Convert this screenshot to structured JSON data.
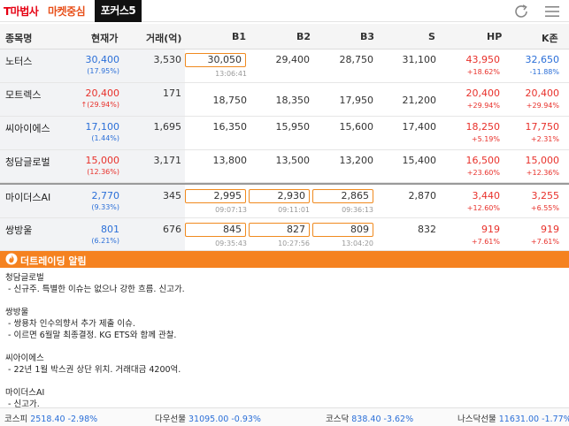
{
  "topbar": {
    "brand": "T마법사",
    "tab_market": "마켓중심",
    "tab_focus": "포커스5"
  },
  "icons": {
    "refresh": "refresh-icon",
    "menu": "menu-icon",
    "alert": "fire-icon"
  },
  "colors": {
    "up": "#e8312b",
    "down": "#2b6fd8",
    "accent": "#f58220",
    "highlight_border": "#f08a1f"
  },
  "table": {
    "headers": {
      "name": "종목명",
      "price": "현재가",
      "volume": "거래(억)",
      "b1": "B1",
      "b2": "B2",
      "b3": "B3",
      "s": "S",
      "hp": "HP",
      "kstop": "K존"
    },
    "rows": [
      {
        "name": "노터스",
        "price": "30,400",
        "pct": "(17.95%)",
        "volume": "3,530",
        "b1": "30,050",
        "b1_time": "13:06:41",
        "b2": "29,400",
        "b3": "28,750",
        "s": "31,100",
        "hp": "43,950",
        "hp_pct": "+18.62%",
        "k": "32,650",
        "k_pct": "-11.88%"
      },
      {
        "name": "모트렉스",
        "price": "20,400",
        "pct": "↑(29.94%)",
        "volume": "171",
        "b1": "18,750",
        "b2": "18,350",
        "b3": "17,950",
        "s": "21,200",
        "hp": "20,400",
        "hp_pct": "+29.94%",
        "k": "20,400",
        "k_pct": "+29.94%"
      },
      {
        "name": "씨아이에스",
        "price": "17,100",
        "pct": "(1.44%)",
        "volume": "1,695",
        "b1": "16,350",
        "b2": "15,950",
        "b3": "15,600",
        "s": "17,400",
        "hp": "18,250",
        "hp_pct": "+5.19%",
        "k": "17,750",
        "k_pct": "+2.31%"
      },
      {
        "name": "청담글로벌",
        "price": "15,000",
        "pct": "(12.36%)",
        "volume": "3,171",
        "b1": "13,800",
        "b2": "13,500",
        "b3": "13,200",
        "s": "15,400",
        "hp": "16,500",
        "hp_pct": "+23.60%",
        "k": "15,000",
        "k_pct": "+12.36%"
      },
      {
        "name": "마이더스AI",
        "price": "2,770",
        "pct": "(9.33%)",
        "volume": "345",
        "b1": "2,995",
        "b1_time": "09:07:13",
        "b2": "2,930",
        "b2_time": "09:11:01",
        "b3": "2,865",
        "b3_time": "09:36:13",
        "s": "2,870",
        "hp": "3,440",
        "hp_pct": "+12.60%",
        "k": "3,255",
        "k_pct": "+6.55%"
      },
      {
        "name": "쌍방울",
        "price": "801",
        "pct": "(6.21%)",
        "volume": "676",
        "b1": "845",
        "b1_time": "09:35:43",
        "b2": "827",
        "b2_time": "10:27:56",
        "b3": "809",
        "b3_time": "13:04:20",
        "s": "832",
        "hp": "919",
        "hp_pct": "+7.61%",
        "k": "919",
        "k_pct": "+7.61%"
      }
    ]
  },
  "alert": {
    "title": "더트레이딩 알림",
    "lines": [
      "청담글로벌",
      " - 신규주. 특별한 이슈는 없으나 강한 흐름. 신고가.",
      "",
      "쌍방울",
      " - 쌍용차 인수의향서 추가 제출 이슈.",
      " - 이르면 6월말 최종결정. KG ETS와 함께 관찰.",
      "",
      "씨아이에스",
      " - 22년 1월 박스권 상단 위치. 거래대금 4200억.",
      "",
      "마이더스AI",
      " - 신고가."
    ]
  },
  "ticker": {
    "kospi_name": "코스피",
    "kospi_val": "2518.40 -2.98%",
    "dow_name": "다우선물",
    "dow_val": "31095.00 -0.93%",
    "kosdaq_name": "코스닥",
    "kosdaq_val": "838.40 -3.62%",
    "nasdaq_name": "나스닥선물",
    "nasdaq_val": "11631.00 -1.77%"
  }
}
